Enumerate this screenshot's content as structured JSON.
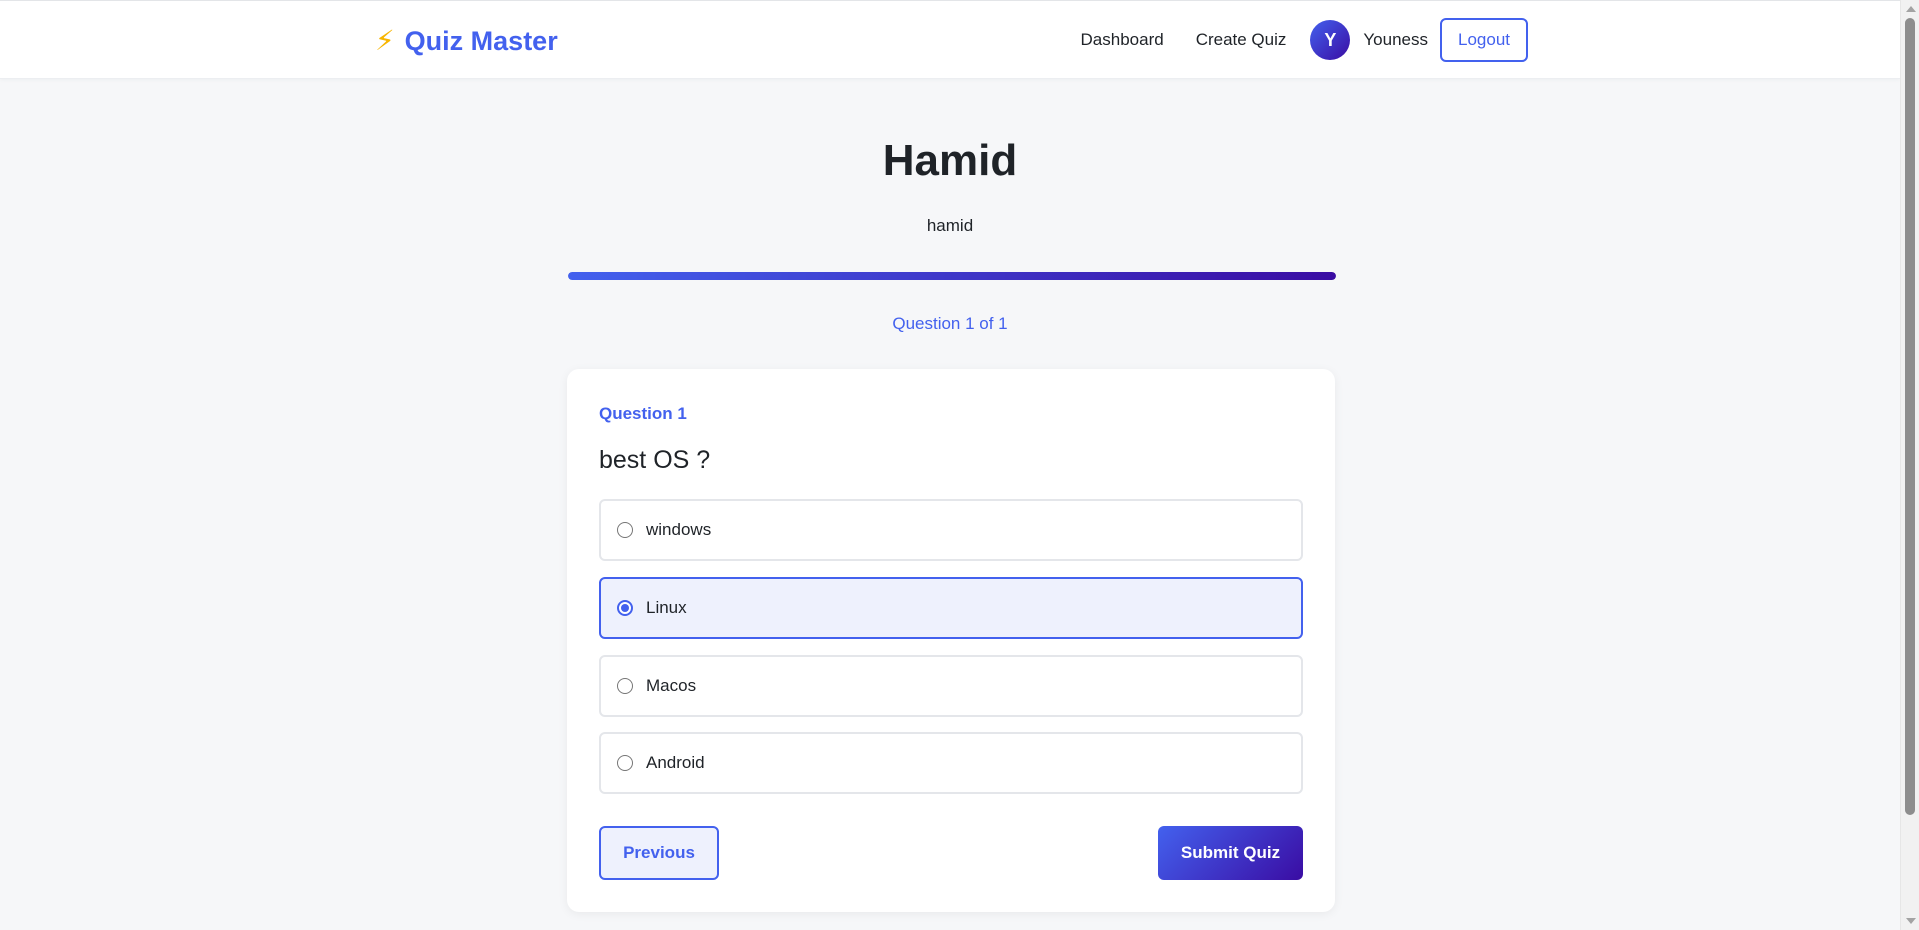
{
  "header": {
    "brand_icon": "bolt-icon",
    "brand_glyph": "⚡",
    "brand_name": "Quiz Master",
    "nav": {
      "dashboard": "Dashboard",
      "create_quiz": "Create Quiz"
    },
    "user": {
      "avatar_initial": "Y",
      "name": "Youness"
    },
    "logout_label": "Logout"
  },
  "quiz": {
    "title": "Hamid",
    "description": "hamid",
    "progress_fraction": 1.0,
    "counter_text": "Question 1 of 1"
  },
  "question": {
    "label": "Question 1",
    "text": "best OS ?",
    "options": [
      {
        "label": "windows",
        "selected": false
      },
      {
        "label": "Linux",
        "selected": true
      },
      {
        "label": "Macos",
        "selected": false
      },
      {
        "label": "Android",
        "selected": false
      }
    ]
  },
  "actions": {
    "previous_label": "Previous",
    "submit_label": "Submit Quiz"
  },
  "colors": {
    "accent": "#4361ee",
    "accent_dark": "#3a0ca3",
    "selected_bg": "#eef1fd",
    "brand_bolt": "#f7b500"
  }
}
